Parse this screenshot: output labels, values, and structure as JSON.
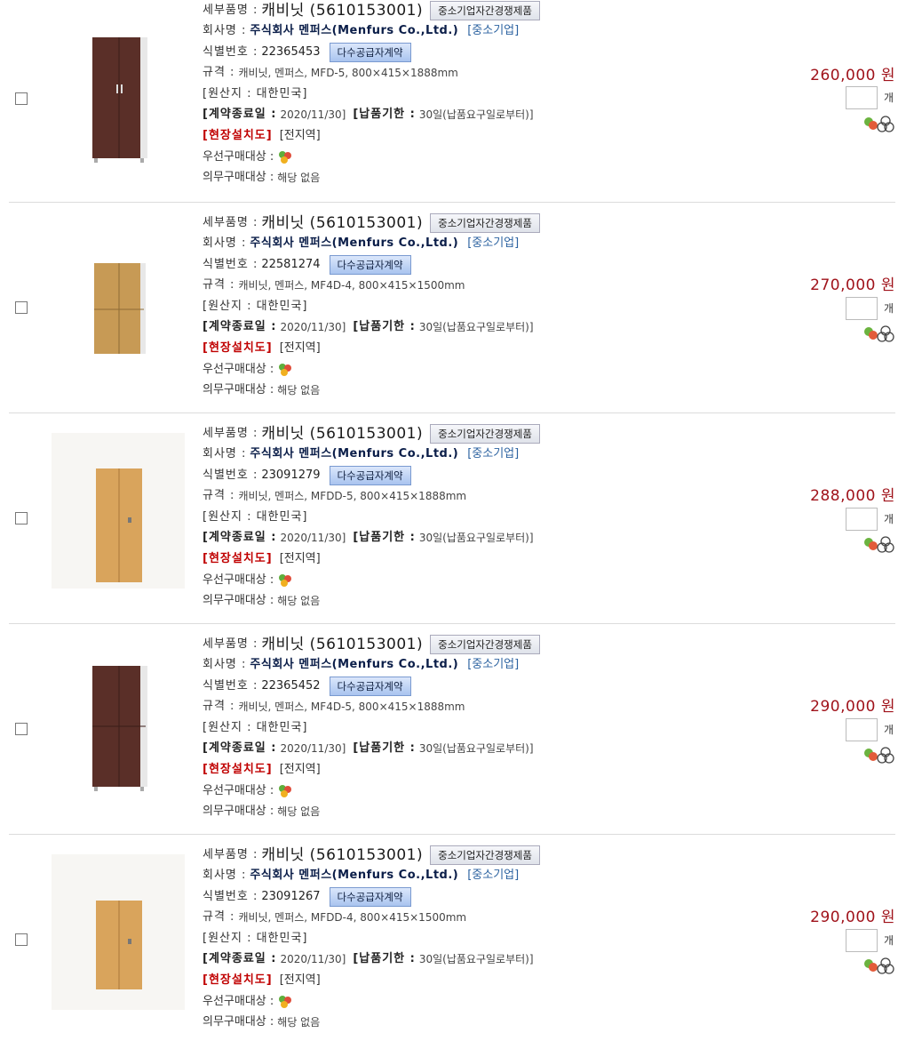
{
  "labels": {
    "detail_name": "세부품명 :",
    "company": "회사명 :",
    "id": "식별번호 :",
    "spec": "규격 :",
    "origin": "[원산지 : 대한민국]",
    "contract_end": "[계약종료일 :",
    "delivery": "[납품기한 :",
    "onsite": "[현장설치도]",
    "region": "[전지역]",
    "priority": "우선구매대상 :",
    "mandatory": "의무구매대상 :",
    "mandatory_value": "해당 없음",
    "unit": "개",
    "badge_sme": "중소기업자간경쟁제품",
    "badge_multi": "다수공급자계약"
  },
  "icons": {
    "priority": "recycle-priority-icon",
    "cart": "cart-icon",
    "compare": "compare-icon"
  },
  "colors": {
    "price": "#a0131b",
    "company": "#0b1e49",
    "classification": "#2b62a0",
    "onsite": "#c00000"
  },
  "products": [
    {
      "product_name": "캐비닛 (5610153001)",
      "company": "주식회사 멘퍼스(Menfurs Co.,Ltd.)",
      "classification": "[중소기업]",
      "id_number": "22365453",
      "spec": "캐비닛, 멘퍼스, MFD-5, 800×415×1888mm",
      "contract_end": "2020/11/30]",
      "delivery": "30일(납품요구일로부터)]",
      "price": "260,000 원",
      "image": "walnut-tall-cabinet"
    },
    {
      "product_name": "캐비닛 (5610153001)",
      "company": "주식회사 멘퍼스(Menfurs Co.,Ltd.)",
      "classification": "[중소기업]",
      "id_number": "22581274",
      "spec": "캐비닛, 멘퍼스, MF4D-4, 800×415×1500mm",
      "contract_end": "2020/11/30]",
      "delivery": "30일(납품요구일로부터)]",
      "price": "270,000 원",
      "image": "oak-four-door-cabinet"
    },
    {
      "product_name": "캐비닛 (5610153001)",
      "company": "주식회사 멘퍼스(Menfurs Co.,Ltd.)",
      "classification": "[중소기업]",
      "id_number": "23091279",
      "spec": "캐비닛, 멘퍼스, MFDD-5, 800×415×1888mm",
      "contract_end": "2020/11/30]",
      "delivery": "30일(납품요구일로부터)]",
      "price": "288,000 원",
      "image": "beech-tall-cabinet"
    },
    {
      "product_name": "캐비닛 (5610153001)",
      "company": "주식회사 멘퍼스(Menfurs Co.,Ltd.)",
      "classification": "[중소기업]",
      "id_number": "22365452",
      "spec": "캐비닛, 멘퍼스, MF4D-5, 800×415×1888mm",
      "contract_end": "2020/11/30]",
      "delivery": "30일(납품요구일로부터)]",
      "price": "290,000 원",
      "image": "walnut-four-door-cabinet"
    },
    {
      "product_name": "캐비닛 (5610153001)",
      "company": "주식회사 멘퍼스(Menfurs Co.,Ltd.)",
      "classification": "[중소기업]",
      "id_number": "23091267",
      "spec": "캐비닛, 멘퍼스, MFDD-4, 800×415×1500mm",
      "contract_end": "2020/11/30]",
      "delivery": "30일(납품요구일로부터)]",
      "price": "290,000 원",
      "image": "beech-short-cabinet"
    }
  ]
}
